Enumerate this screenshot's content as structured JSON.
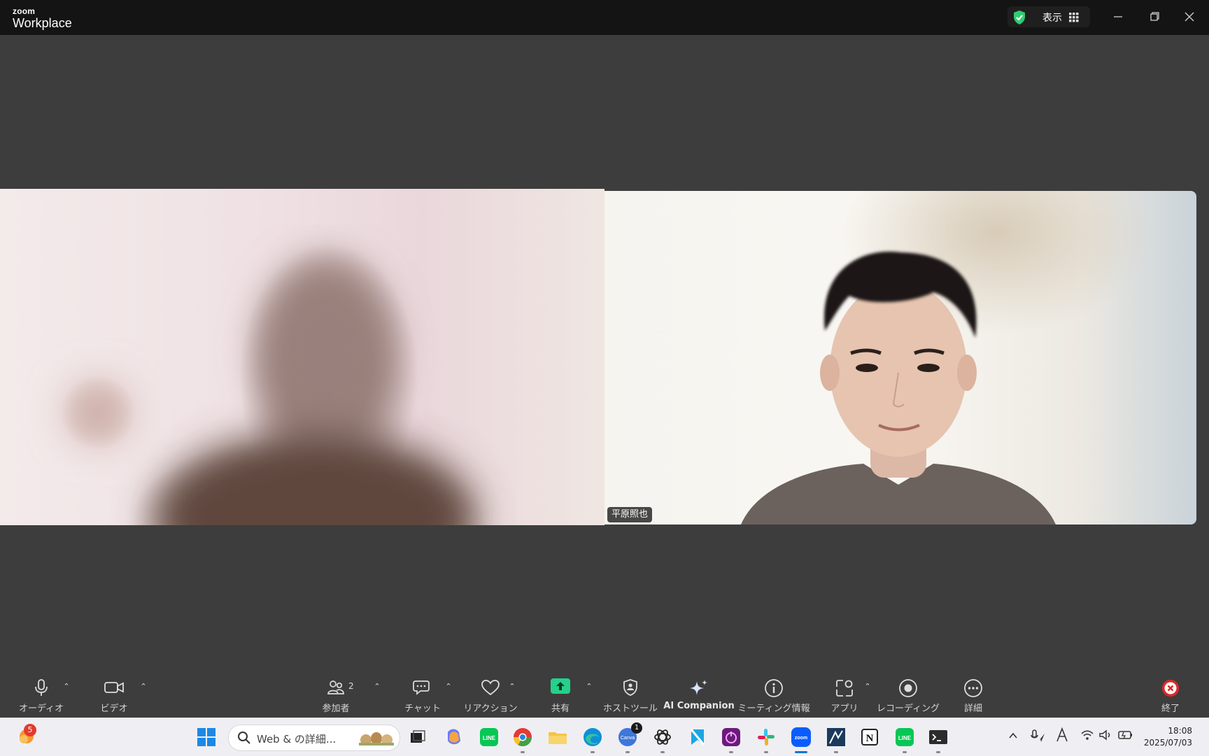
{
  "titlebar": {
    "logo_top": "zoom",
    "logo_bottom": "Workplace",
    "view_label": "表示"
  },
  "participants": {
    "right_name": "平原照也"
  },
  "toolbar": {
    "audio": "オーディオ",
    "video": "ビデオ",
    "participants": "参加者",
    "participants_count": "2",
    "chat": "チャット",
    "reactions": "リアクション",
    "share": "共有",
    "host_tools": "ホストツール",
    "ai_companion": "AI Companion",
    "meeting_info": "ミーティング情報",
    "apps": "アプリ",
    "recording": "レコーディング",
    "more": "詳細",
    "end": "終了"
  },
  "taskbar": {
    "search_text": "Web & の詳細...",
    "notification_count": "5",
    "canva_badge": "1",
    "time": "18:08",
    "date": "2025/07/03"
  },
  "colors": {
    "titlebar_bg": "#141414",
    "meeting_bg": "#3d3d3d",
    "share_green": "#23d18b",
    "end_red": "#e02828",
    "shield_green": "#2ecc71"
  }
}
